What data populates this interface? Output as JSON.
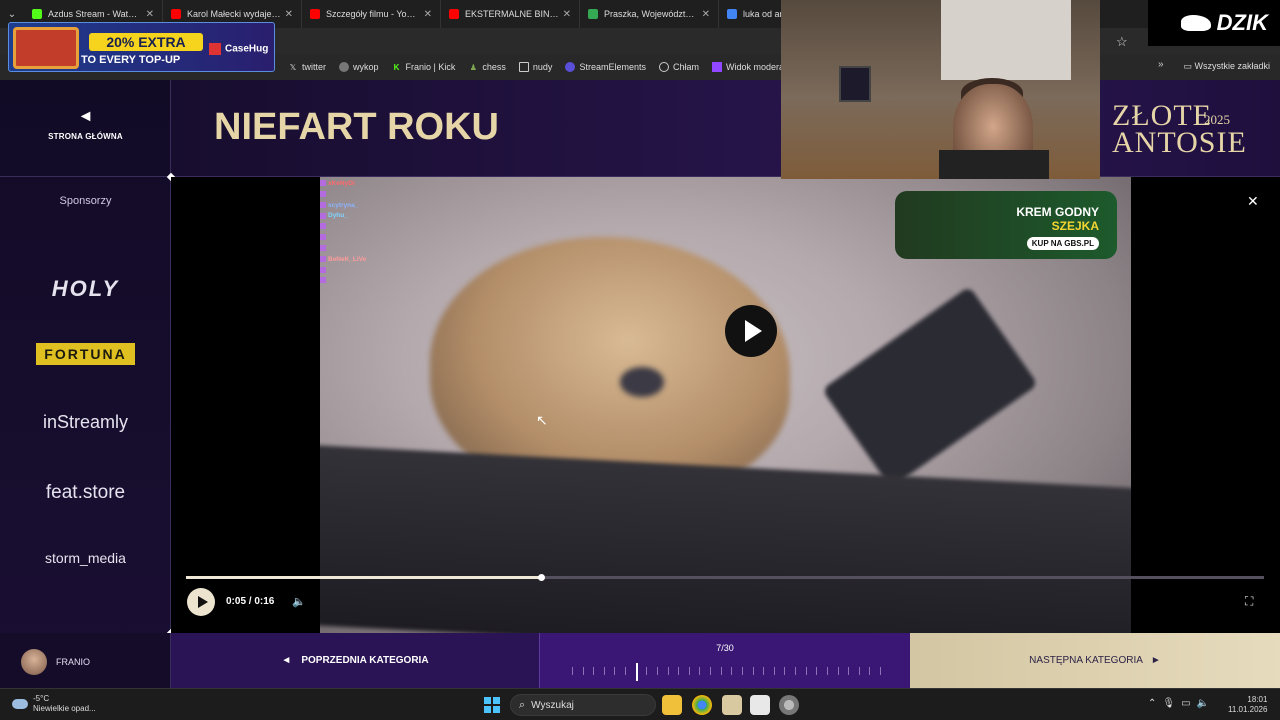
{
  "browser": {
    "tabs": [
      {
        "title": "Azdus Stream - Watch Liv",
        "color": "#53fc18"
      },
      {
        "title": "Karol Małecki wydaje dźw",
        "color": "#ff0000"
      },
      {
        "title": "Szczegóły filmu - YouTub",
        "color": "#ff0000"
      },
      {
        "title": "EKSTERMALNE BINGO NA",
        "color": "#ff0000"
      },
      {
        "title": "Praszka, Województwo op",
        "color": "#34a853"
      },
      {
        "title": "luka od ano",
        "color": "#4285f4"
      }
    ],
    "bookmarks": [
      {
        "label": "twitter",
        "icon": "x-icon"
      },
      {
        "label": "wykop",
        "icon": "wykop-icon"
      },
      {
        "label": "Franio | Kick",
        "icon": "kick-icon"
      },
      {
        "label": "chess",
        "icon": "chess-icon"
      },
      {
        "label": "nudy",
        "icon": "folder-icon"
      },
      {
        "label": "StreamElements",
        "icon": "streamelements-icon"
      },
      {
        "label": "Chłam",
        "icon": "globe-icon"
      },
      {
        "label": "Widok moderatora...",
        "icon": "twitch-icon"
      }
    ],
    "all_bookmarks": "Wszystkie zakładki"
  },
  "promo": {
    "extra": "20% EXTRA",
    "subtitle": "TO EVERY TOP-UP",
    "brand": "CaseHug"
  },
  "page": {
    "home_label": "STRONA GŁÓWNA",
    "title": "NIEFART ROKU",
    "brand_title": "ZŁOTE ANTOSIE",
    "brand_year": "2025",
    "sponsors_label": "Sponsorzy",
    "sponsors": [
      "HOLY",
      "FORTUNA",
      "inStreamly",
      "feat.store",
      "storm_media"
    ]
  },
  "video": {
    "time": "0:05 / 0:16",
    "progress": 0.329,
    "chat": [
      {
        "user": "xKeNyDi",
        "color": "#ff6a6a"
      },
      {
        "user": "xcytryna_",
        "color": "#8ab4ff"
      },
      {
        "user": "Dyhu_",
        "color": "#7fd4ff"
      },
      {
        "user": "BeNeK_LiVe",
        "color": "#ff9a9a"
      }
    ],
    "ad": {
      "line1": "KREM GODNY",
      "line2": "SZEJKA",
      "cta": "KUP NA GBS.PL"
    }
  },
  "bottom": {
    "username": "FRANIO",
    "prev_label": "POPRZEDNIA KATEGORIA",
    "next_label": "NASTĘPNA KATEGORIA",
    "counter": "7/30",
    "current": 7,
    "total": 30
  },
  "overlay": {
    "dzik": "DZIK"
  },
  "taskbar": {
    "temp": "-5°C",
    "weather": "Niewielkie opad...",
    "search": "Wyszukaj",
    "time": "18:01",
    "date": "11.01.2026"
  }
}
